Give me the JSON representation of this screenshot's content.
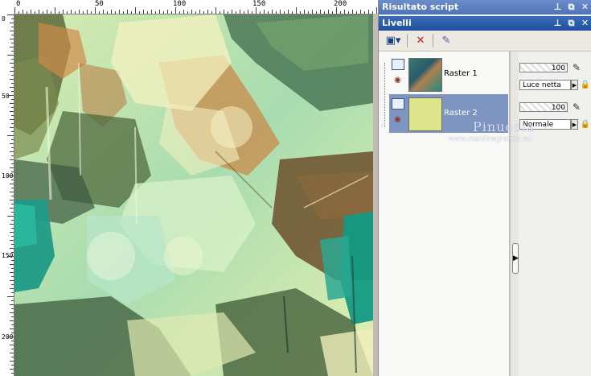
{
  "ruler": {
    "top_labels": [
      "0",
      "50",
      "100",
      "150",
      "200"
    ],
    "left_labels": [
      "0",
      "50",
      "100",
      "150",
      "200"
    ]
  },
  "script_panel": {
    "title": "Risultato script",
    "pin_label": "⊥",
    "restore_label": "⧉",
    "close_label": "✕"
  },
  "layers_panel": {
    "title": "Livelli",
    "pin_label": "⊥",
    "restore_label": "⧉",
    "close_label": "✕",
    "toolbar": {
      "new_layer_icon": "▣▾",
      "delete_layer_icon": "✕",
      "edit_icon": "✎"
    },
    "layers": [
      {
        "name": "Raster 1",
        "opacity": "100",
        "blend_mode": "Luce netta",
        "selected": false,
        "thumb_color": "#3a7a74"
      },
      {
        "name": "Raster 2",
        "opacity": "100",
        "blend_mode": "Normale",
        "selected": true,
        "thumb_color": "#dde489"
      }
    ],
    "eye_icon": "◉",
    "lock_icon": "🔒",
    "splitter_arrow": "▶",
    "blend_arrow": "▶"
  },
  "watermark": {
    "name": "Pinuccia",
    "url": "www.maidiregrafica.eu"
  },
  "colors": {
    "title_active": "#2a5aa8",
    "selected_row": "#7f95c1",
    "art_teal": "#1f9a86",
    "art_brown": "#6b5a34",
    "art_cream": "#f2f0bc"
  }
}
